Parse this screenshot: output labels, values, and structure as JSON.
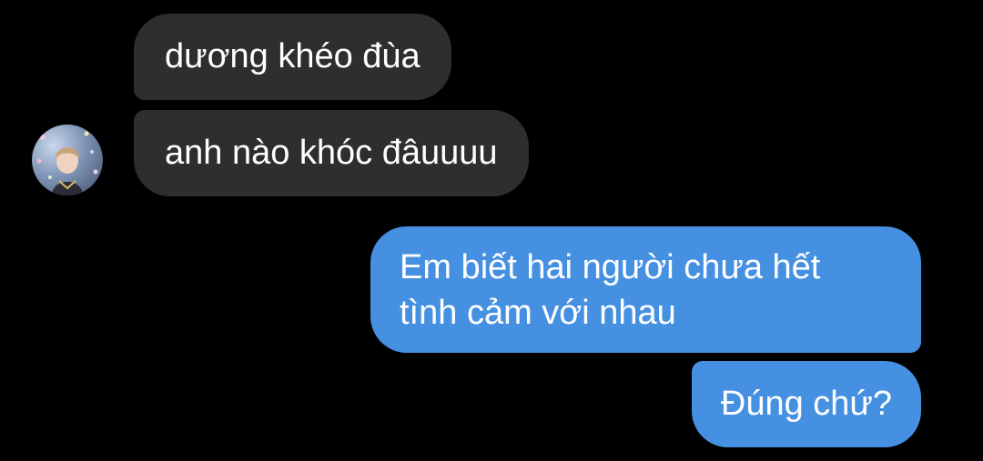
{
  "conversation": {
    "messages": [
      {
        "sender": "other",
        "text": "dương khéo đùa"
      },
      {
        "sender": "other",
        "text": "anh nào khóc đâuuuu"
      },
      {
        "sender": "me",
        "lines": [
          "Em biết hai người chưa hết",
          "tình cảm với nhau"
        ]
      },
      {
        "sender": "me",
        "text": "Đúng chứ?"
      }
    ],
    "avatar_icon": "profile-photo",
    "colors": {
      "background": "#000000",
      "incoming_bubble": "#2e2e2e",
      "outgoing_bubble": "#4690e2",
      "text": "#ffffff"
    }
  }
}
